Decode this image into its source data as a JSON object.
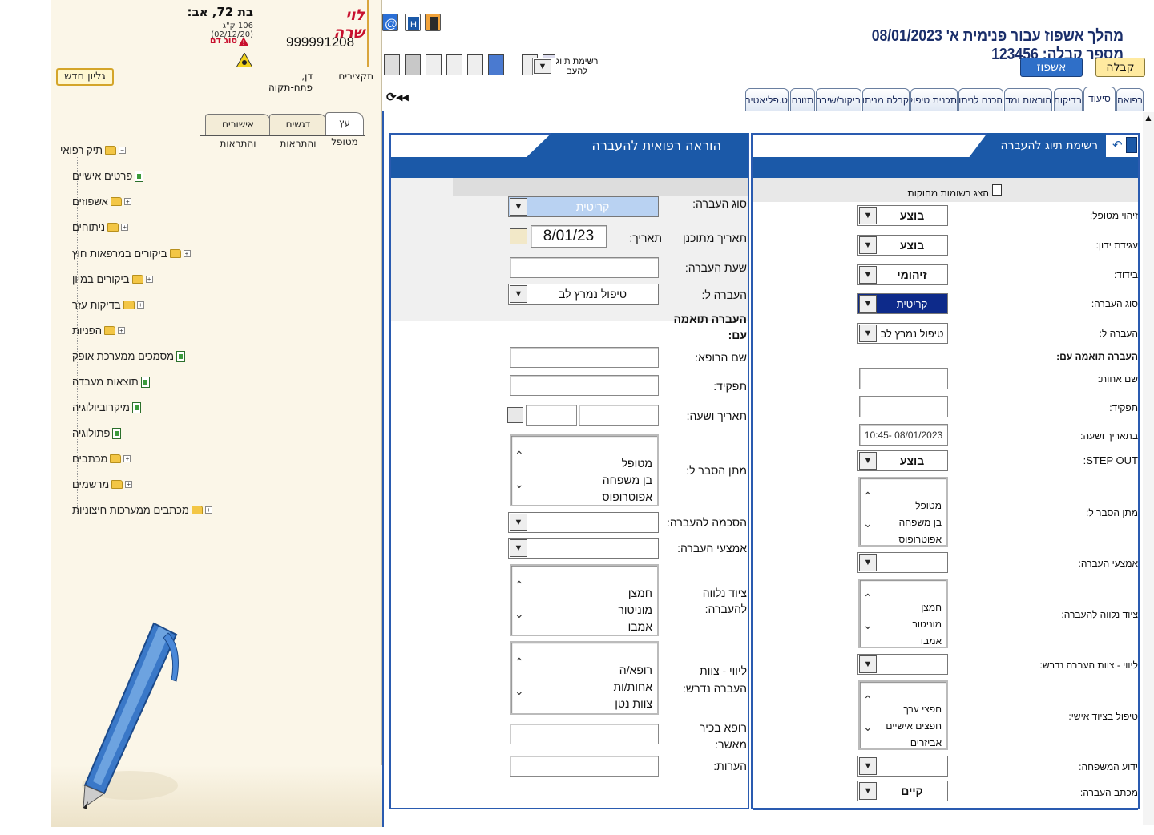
{
  "patient": {
    "name": "לוי שרה",
    "age_gender": "בת 72, אב:",
    "id": "999991208",
    "weight": "106 ק\"ג (02/12/20)",
    "blood": "סוג דם",
    "doctor": "דן, פתח-תקוה",
    "summaries": "תקצירים"
  },
  "left": {
    "new_sheet": "גליון חדש",
    "tabs": [
      "עץ מטופל",
      "דגשים והתראות",
      "אישורים והתראות"
    ],
    "tree_root": "תיק רפואי",
    "tree": [
      "פרטים אישיים",
      "אשפוזים",
      "ניתוחים",
      "ביקורים במרפאות חוץ",
      "ביקורים במיון",
      "בדיקות עזר",
      "הפניות",
      "מסמכים ממערכת אופק",
      "תוצאות מעבדה",
      "מיקרוביולוגיה",
      "פתולוגיה",
      "מכתבים",
      "מרשמים",
      "מכתבים ממערכות חיצוניות"
    ]
  },
  "header": {
    "title": "מהלך אשפוז עבור פנימית א' 08/01/2023 מספר קבלה: 123456",
    "btn_accept": "קבלה",
    "btn_admit": "אשפוז",
    "list_select": "רשימת תיוג להעב"
  },
  "tabs": [
    "רפואה",
    "סיעוד",
    "בדיקות",
    "הוראות ומדדי",
    "הכנה לניתוח",
    "תכנית טיפול",
    "קבלה מניתוח",
    "ביקור/שיבה",
    "תזונה",
    "ט.פליאטיבי"
  ],
  "left_panel": {
    "title": "הוראה רפואית להעברה",
    "transfer_type": "סוג העברה:",
    "transfer_type_val": "קריטית",
    "planned_date": "תאריך מתוכנן",
    "date_lbl": "תאריך:",
    "date_val": "8/01/23",
    "transfer_time": "שעת העברה:",
    "transfer_to": "העברה ל:",
    "transfer_to_val": "טיפול נמרץ לב",
    "coordinated": "העברה תואמה עם:",
    "doctor_name": "שם הרופא:",
    "role": "תפקיד:",
    "datetime": "תאריך ושעה:",
    "explain_to": "מתן הסבר ל:",
    "explain_list": [
      "מטופל",
      "בן משפחה",
      "אפוטרופוס"
    ],
    "consent": "הסכמה להעברה:",
    "means": "אמצעי העברה:",
    "equipment": "ציוד נלווה להעברה:",
    "equipment_list": [
      "חמצן",
      "מוניטור",
      "אמבו"
    ],
    "escort": "ליווי - צוות העברה נדרש:",
    "escort_list": [
      "רופא/ה",
      "אחות/ות",
      "צוות נטן"
    ],
    "approver": "רופא בכיר מאשר:",
    "notes": "הערות:"
  },
  "right_panel": {
    "title": "רשימת תיוג להעברה",
    "show_deleted": "הצג רשומות מחוקות",
    "rows": [
      {
        "label": "זיהוי מטופל:",
        "val": "בוצע"
      },
      {
        "label": "עגידת ידון:",
        "val": "בוצע"
      },
      {
        "label": "בידוד:",
        "val": "זיהומי"
      },
      {
        "label": "סוג העברה:",
        "val": "קריטית"
      },
      {
        "label": "העברה ל:",
        "val": "טיפול נמרץ לב"
      }
    ],
    "coordinated": "העברה תואמה עם:",
    "nurse_name": "שם אחות:",
    "role": "תפקיד:",
    "datetime": "בתאריך ושעה:",
    "datetime_val": "10:45- 08/01/2023",
    "stepout": "STEP OUT:",
    "stepout_val": "בוצע",
    "explain_to": "מתן הסבר ל:",
    "explain_list": [
      "מטופל",
      "בן משפחה",
      "אפוטרופוס"
    ],
    "means": "אמצעי העברה:",
    "equipment": "ציוד נלווה להעברה:",
    "equipment_list": [
      "חמצן",
      "מוניטור",
      "אמבו"
    ],
    "escort": "ליווי - צוות העברה נדרש:",
    "personal": "טיפול בציוד אישי:",
    "personal_list": [
      "חפצי ערך",
      "חפצים אישיים",
      "אביזרים"
    ],
    "family": "ידוע המשפחה:",
    "letter": "מכתב העברה:",
    "letter_val": "קיים"
  }
}
